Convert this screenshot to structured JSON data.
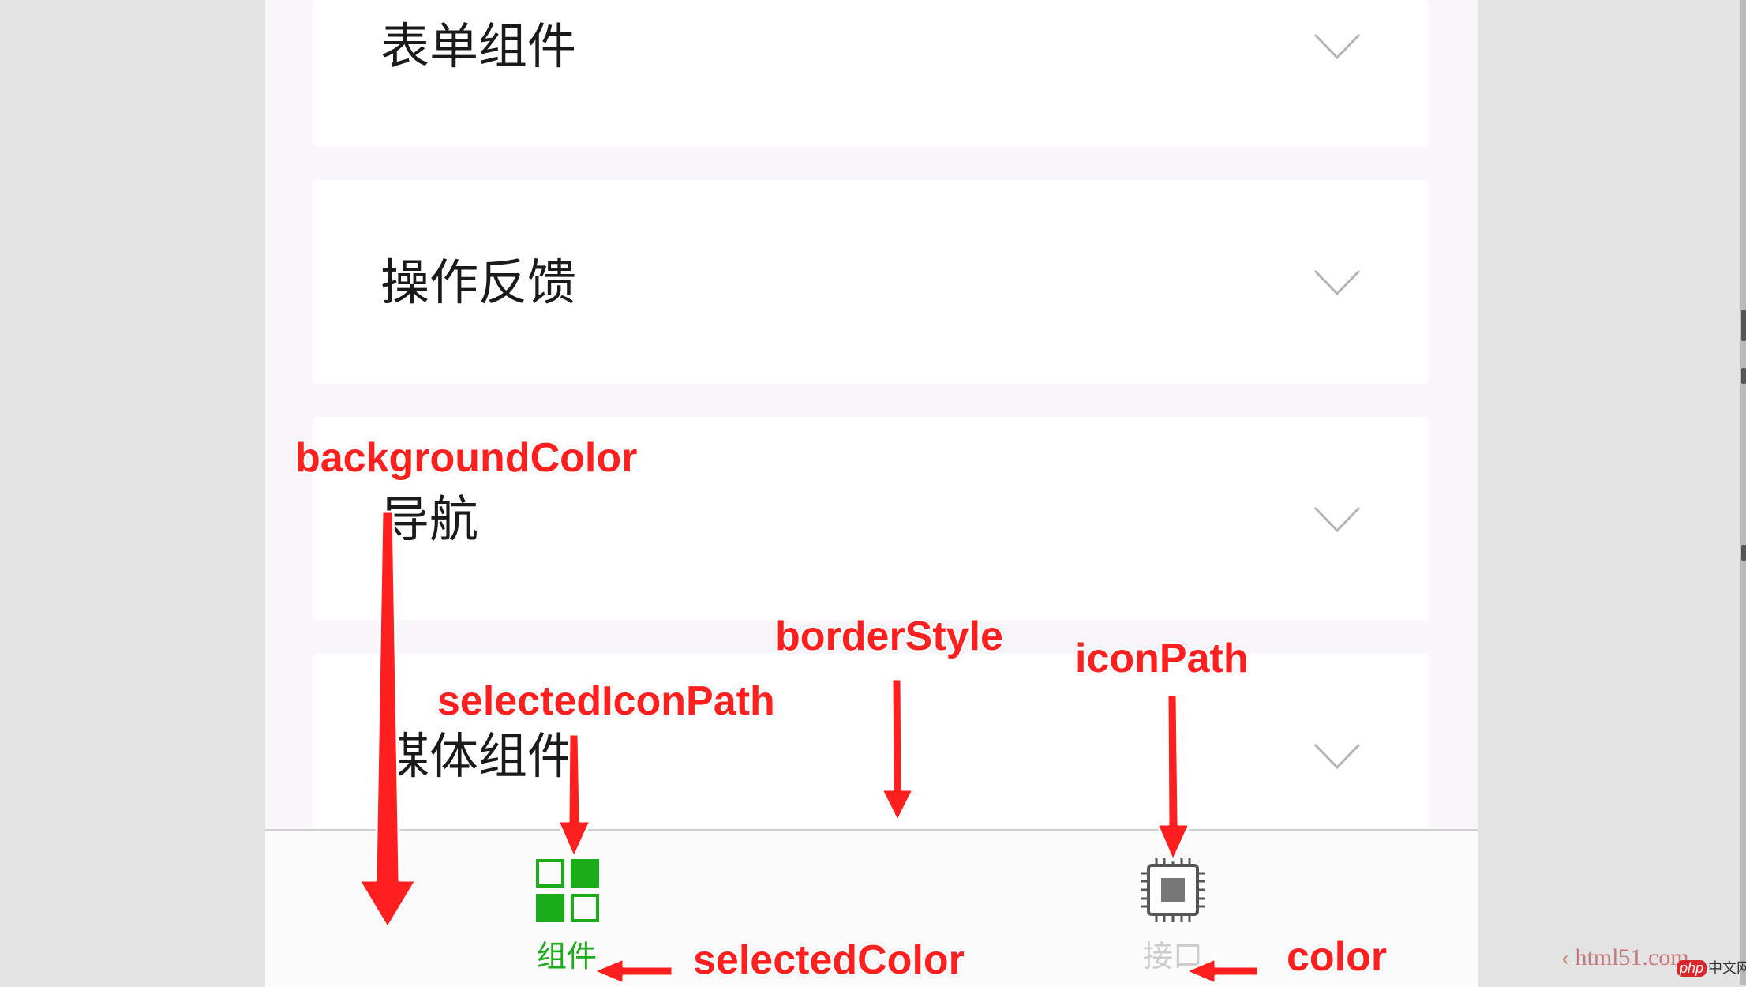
{
  "menu": {
    "items": [
      {
        "label": "表单组件"
      },
      {
        "label": "操作反馈"
      },
      {
        "label": "导航"
      },
      {
        "label": "媒体组件"
      }
    ]
  },
  "tabbar": {
    "tabs": [
      {
        "label": "组件",
        "icon": "grid-icon",
        "selected": true
      },
      {
        "label": "接口",
        "icon": "chip-icon",
        "selected": false
      }
    ],
    "selected_color": "#1aad19",
    "color": "#cccccc",
    "background_color": "#fbfbfb"
  },
  "annotations": {
    "background_color": "backgroundColor",
    "border_style": "borderStyle",
    "icon_path": "iconPath",
    "selected_icon_path": "selectedIconPath",
    "selected_color": "selectedColor",
    "color": "color",
    "color_hex": "#ff1f1f"
  },
  "watermark": {
    "site": "‹ html51.com",
    "badge_php": "php",
    "badge_text": "中文网"
  }
}
